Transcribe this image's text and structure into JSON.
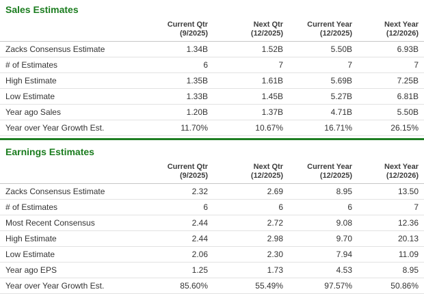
{
  "theme": {
    "title_green": "#1a7c1e",
    "divider_green": "#1e7e22",
    "header_border": "#c6c6c6",
    "row_border": "#e2e2e2",
    "text_color": "#333333"
  },
  "columns": [
    {
      "label": "Current Qtr",
      "period": "(9/2025)"
    },
    {
      "label": "Next Qtr",
      "period": "(12/2025)"
    },
    {
      "label": "Current Year",
      "period": "(12/2025)"
    },
    {
      "label": "Next Year",
      "period": "(12/2026)"
    }
  ],
  "sections": [
    {
      "title": "Sales Estimates",
      "rows": [
        {
          "label": "Zacks Consensus Estimate",
          "values": [
            "1.34B",
            "1.52B",
            "5.50B",
            "6.93B"
          ]
        },
        {
          "label": "# of Estimates",
          "values": [
            "6",
            "7",
            "7",
            "7"
          ]
        },
        {
          "label": "High Estimate",
          "values": [
            "1.35B",
            "1.61B",
            "5.69B",
            "7.25B"
          ]
        },
        {
          "label": "Low Estimate",
          "values": [
            "1.33B",
            "1.45B",
            "5.27B",
            "6.81B"
          ]
        },
        {
          "label": "Year ago Sales",
          "values": [
            "1.20B",
            "1.37B",
            "4.71B",
            "5.50B"
          ]
        },
        {
          "label": "Year over Year Growth Est.",
          "values": [
            "11.70%",
            "10.67%",
            "16.71%",
            "26.15%"
          ]
        }
      ]
    },
    {
      "title": "Earnings Estimates",
      "rows": [
        {
          "label": "Zacks Consensus Estimate",
          "values": [
            "2.32",
            "2.69",
            "8.95",
            "13.50"
          ]
        },
        {
          "label": "# of Estimates",
          "values": [
            "6",
            "6",
            "6",
            "7"
          ]
        },
        {
          "label": "Most Recent Consensus",
          "values": [
            "2.44",
            "2.72",
            "9.08",
            "12.36"
          ]
        },
        {
          "label": "High Estimate",
          "values": [
            "2.44",
            "2.98",
            "9.70",
            "20.13"
          ]
        },
        {
          "label": "Low Estimate",
          "values": [
            "2.06",
            "2.30",
            "7.94",
            "11.09"
          ]
        },
        {
          "label": "Year ago EPS",
          "values": [
            "1.25",
            "1.73",
            "4.53",
            "8.95"
          ]
        },
        {
          "label": "Year over Year Growth Est.",
          "values": [
            "85.60%",
            "55.49%",
            "97.57%",
            "50.86%"
          ]
        }
      ]
    }
  ]
}
